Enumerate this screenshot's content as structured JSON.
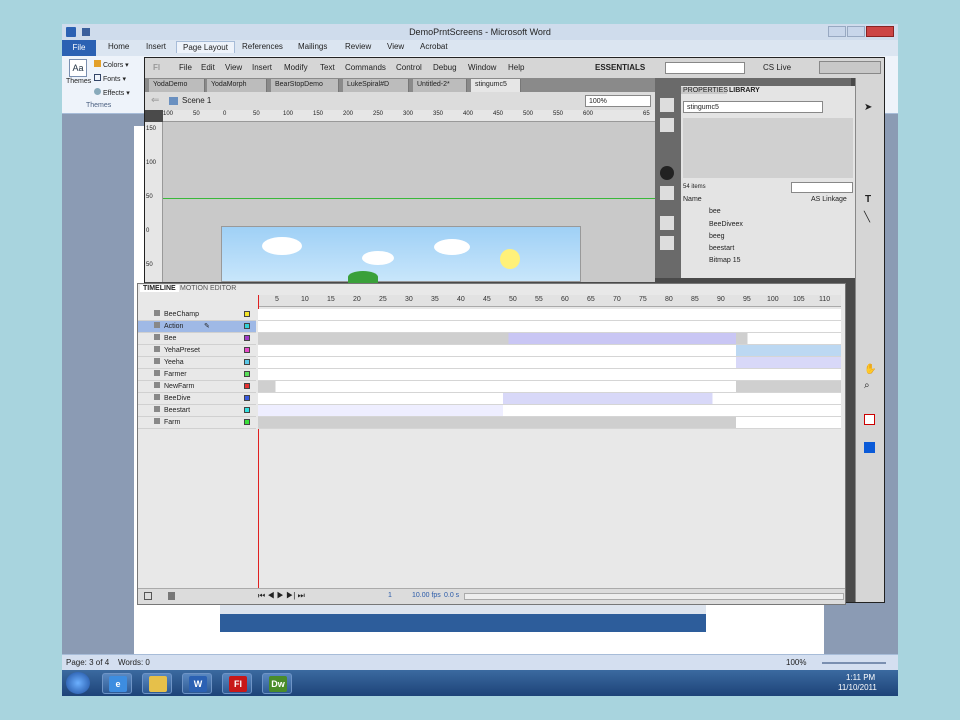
{
  "word": {
    "title": "DemoPrntScreens - Microsoft Word",
    "file_tab": "File",
    "ribbon_tabs": [
      "Home",
      "Insert",
      "Page Layout",
      "References",
      "Mailings",
      "Review",
      "View",
      "Acrobat"
    ],
    "themes": {
      "label": "Themes",
      "group": "Themes",
      "colors": "Colors",
      "fonts": "Fonts",
      "effects": "Effects"
    },
    "status": {
      "page": "Page: 3 of 4",
      "words": "Words: 0",
      "zoom": "100%"
    },
    "taskbar": {
      "time": "1:11 PM",
      "date": "11/10/2011",
      "apps": [
        "W",
        "Fl",
        "Dw"
      ]
    }
  },
  "flash": {
    "logo": "Fl",
    "menu": [
      "File",
      "Edit",
      "View",
      "Insert",
      "Modify",
      "Text",
      "Commands",
      "Control",
      "Debug",
      "Window",
      "Help"
    ],
    "workspace": "ESSENTIALS",
    "cs_live": "CS Live",
    "doc_tabs": [
      "YodaDemo",
      "YodaMorph",
      "BearStopDemo",
      "LukeSpiral#D",
      "Untitled-2*",
      "stingumc5"
    ],
    "scene": "Scene 1",
    "zoom": "100%",
    "ruler_ticks": [
      "100",
      "50",
      "0",
      "50",
      "100",
      "150",
      "200",
      "250",
      "300",
      "350",
      "400",
      "450",
      "500",
      "550",
      "600",
      "65"
    ],
    "vruler_ticks": [
      "150",
      "100",
      "50",
      "0",
      "50"
    ],
    "panel_tabs": [
      "PROPERTIES",
      "LIBRARY"
    ],
    "library": {
      "doc": "stingumc5",
      "count": "54 items",
      "col_name": "Name",
      "col_linkage": "AS Linkage",
      "items": [
        "bee",
        "BeeDiveex",
        "beeg",
        "beestart",
        "Bitmap 15"
      ]
    },
    "timeline": {
      "tabs": [
        "TIMELINE",
        "MOTION EDITOR"
      ],
      "frame_numbers": [
        "5",
        "10",
        "15",
        "20",
        "25",
        "30",
        "35",
        "40",
        "45",
        "50",
        "55",
        "60",
        "65",
        "70",
        "75",
        "80",
        "85",
        "90",
        "95",
        "100",
        "105",
        "110"
      ],
      "layers": [
        {
          "name": "BeeChamp",
          "color": "#f5e62a"
        },
        {
          "name": "Action",
          "color": "#34d0d6"
        },
        {
          "name": "Bee",
          "color": "#a03cc8"
        },
        {
          "name": "YehaPreset",
          "color": "#e64ac8"
        },
        {
          "name": "Yeeha",
          "color": "#5ac8e8"
        },
        {
          "name": "Farmer",
          "color": "#5ae05a"
        },
        {
          "name": "NewFarm",
          "color": "#e63232"
        },
        {
          "name": "BeeDive",
          "color": "#3a5ae0"
        },
        {
          "name": "Beestart",
          "color": "#34e0e0"
        },
        {
          "name": "Farm",
          "color": "#3ae03a"
        }
      ],
      "footer": {
        "frame": "1",
        "fps": "10.00 fps",
        "time": "0.0 s"
      }
    }
  },
  "colors": {
    "word_blue": "#2b61b3",
    "flash_red": "#c81818",
    "selected_layer": "#9fb9e6"
  }
}
